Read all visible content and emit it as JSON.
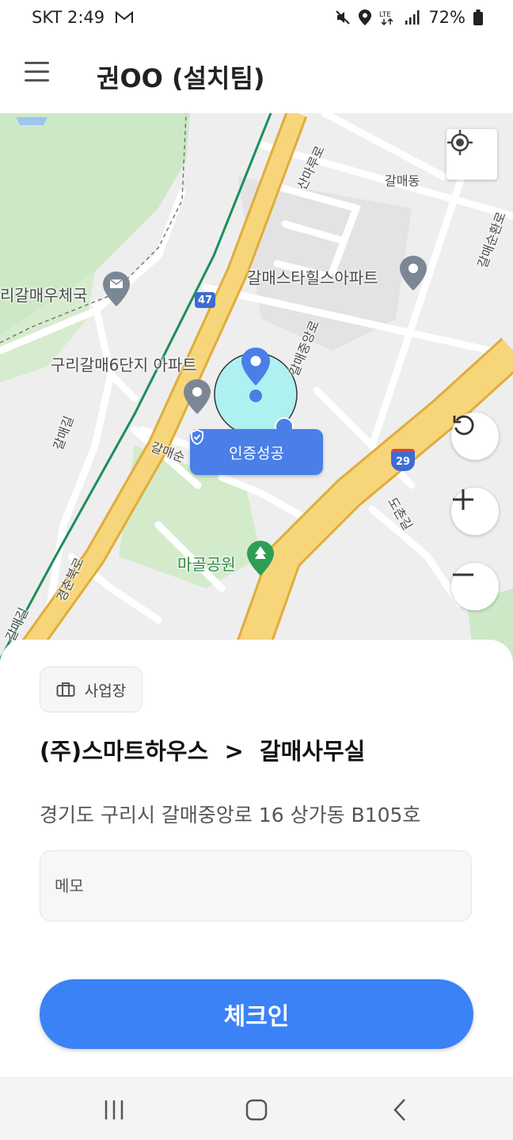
{
  "status_bar": {
    "carrier_time": "SKT 2:49",
    "battery": "72%",
    "icons": [
      "mail-icon",
      "mute-icon",
      "location-icon",
      "lte-icon",
      "signal-icon",
      "battery-icon"
    ]
  },
  "header": {
    "title": "권OO (설치팀)",
    "menu_icon": "hamburger-icon"
  },
  "map": {
    "labels": {
      "galmae_dong": "갈매동",
      "sanmaru_ro": "산마루로",
      "galmae_sunhwan_ro": "갈매순환로",
      "star_hills": "갈매스타힐스아파트",
      "post_office": "리갈매우체국",
      "road_47": "47",
      "galmae_jungang_ro": "갈매중앙로",
      "apt_6": "구리갈매6단지 아파트",
      "galmae_gil": "갈매길",
      "galmae_sun": "갈매순",
      "road_29": "29",
      "dochon_gil": "도촌길",
      "magol_park": "마골공원",
      "gyeongchun_buk_ro": "경춘북로",
      "galmae_gil_2": "갈매길"
    },
    "auth_badge": "인증성공",
    "controls": [
      "crosshair-icon",
      "refresh-icon",
      "plus-icon",
      "minus-icon"
    ]
  },
  "sheet": {
    "chip_label": "사업장",
    "workplace": "(주)스마트하우스  >  갈매사무실",
    "address": "경기도 구리시 갈매중앙로 16 상가동 B105호",
    "memo_placeholder": "메모",
    "checkin_label": "체크인"
  },
  "colors": {
    "primary": "#3b82f6",
    "badge": "#4a7fe8",
    "road_major": "#f5cf6e",
    "rail": "#1a8f5a",
    "park": "#cde8c6"
  }
}
